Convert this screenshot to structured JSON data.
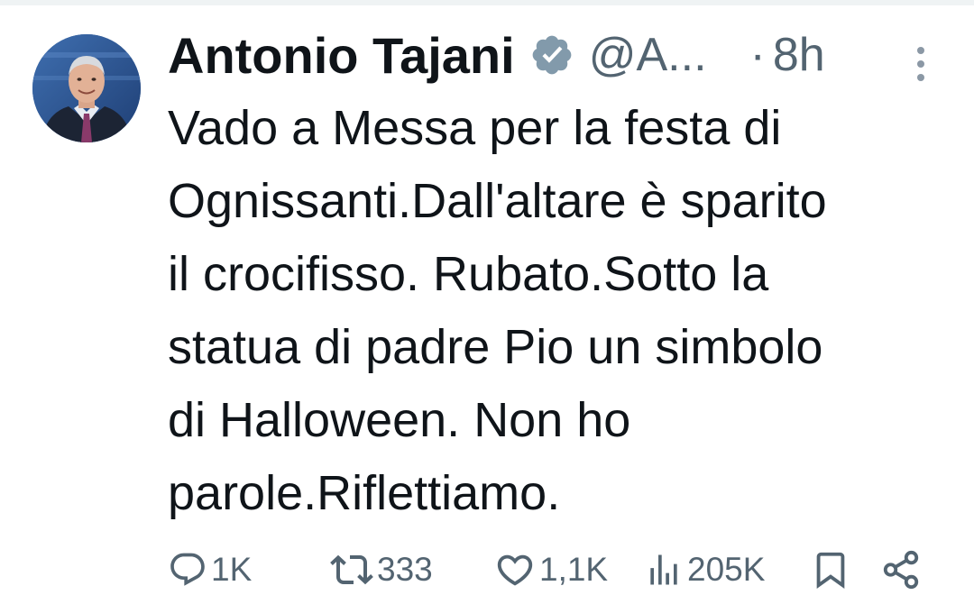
{
  "tweet": {
    "author": {
      "display_name": "Antonio Tajani",
      "handle": "@A...",
      "verified_icon": "verified-badge-icon"
    },
    "separator": "·",
    "time": "8h",
    "text": "Vado a Messa per la festa di\nOgnissanti.Dall'altare è sparito\nil crocifisso. Rubato.Sotto la\nstatua di padre Pio un simbolo\ndi Halloween. Non ho\nparole.Riflettiamo.",
    "stats": {
      "replies": "1K",
      "retweets": "333",
      "likes": "1,1K",
      "views": "205K"
    }
  },
  "icons": {
    "reply": "reply-icon",
    "retweet": "retweet-icon",
    "like": "like-icon",
    "views": "views-icon",
    "bookmark": "bookmark-icon",
    "share": "share-icon",
    "more": "more-icon"
  },
  "colors": {
    "text": "#0f1419",
    "secondary": "#536471",
    "divider": "#eff3f4"
  }
}
